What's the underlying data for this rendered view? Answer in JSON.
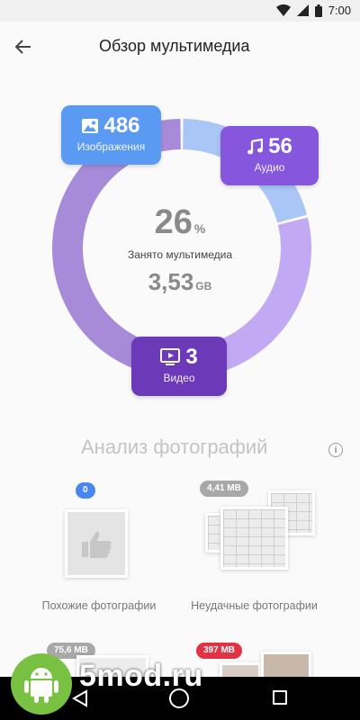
{
  "status_bar": {
    "time": "7:00",
    "icons": [
      "wifi-icon",
      "signal-icon",
      "battery-icon"
    ]
  },
  "app_bar": {
    "title": "Обзор мультимедиа",
    "back_icon": "arrow-back-icon"
  },
  "storage": {
    "percent_value": "26",
    "percent_unit": "%",
    "caption": "Занято мультимедиа",
    "size_value": "3,53",
    "size_unit": "GB",
    "ring_segments": [
      {
        "name": "images",
        "fraction": 0.21,
        "color": "#a9c6f6"
      },
      {
        "name": "audio",
        "fraction": 0.33,
        "color": "#c2a9f3"
      },
      {
        "name": "video",
        "fraction": 0.46,
        "color": "#a88bd8"
      }
    ]
  },
  "categories": {
    "images": {
      "count": "486",
      "label": "Изображения",
      "icon": "image-icon",
      "color": "#5b9af2"
    },
    "audio": {
      "count": "56",
      "label": "Аудио",
      "icon": "music-note-icon",
      "color": "#8656dc"
    },
    "video": {
      "count": "3",
      "label": "Видео",
      "icon": "tv-play-icon",
      "color": "#6c39b8"
    }
  },
  "photo_analysis": {
    "title": "Анализ фотографий",
    "tiles": [
      {
        "badge": "0",
        "label": "Похожие фотографии"
      },
      {
        "badge": "4,41 MB",
        "label": "Неудачные фотографии"
      },
      {
        "badge": "75,6 MB",
        "label": ""
      },
      {
        "badge": "397 MB",
        "label": ""
      }
    ]
  },
  "watermark": {
    "text": "5mod.ru"
  }
}
